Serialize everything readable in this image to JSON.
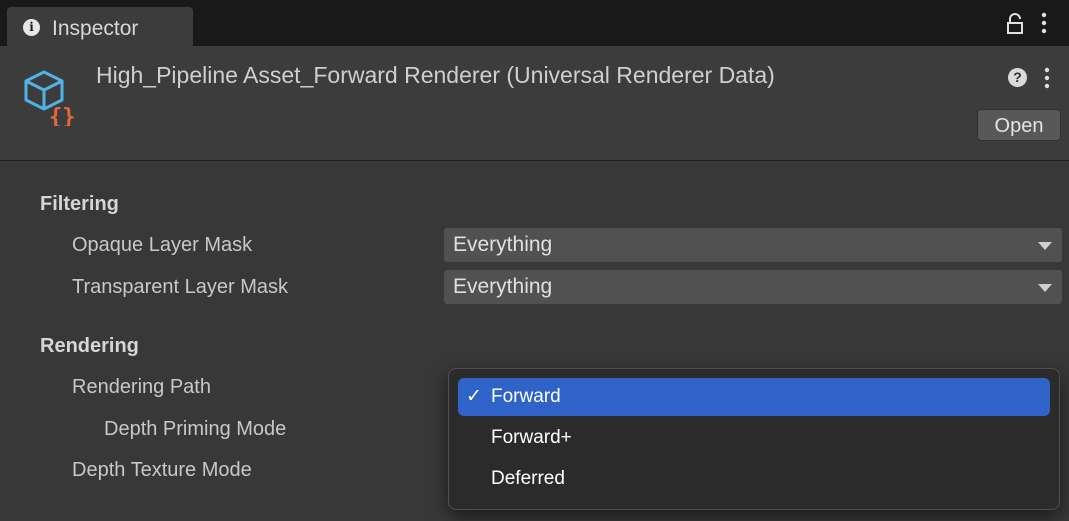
{
  "tab": {
    "title": "Inspector",
    "info_icon": "info-icon"
  },
  "header": {
    "title": "High_Pipeline Asset_Forward Renderer (Universal Renderer Data)",
    "help_glyph": "?",
    "open_label": "Open"
  },
  "filtering": {
    "header": "Filtering",
    "opaque_label": "Opaque Layer Mask",
    "opaque_value": "Everything",
    "transparent_label": "Transparent Layer Mask",
    "transparent_value": "Everything"
  },
  "rendering": {
    "header": "Rendering",
    "path_label": "Rendering Path",
    "depth_priming_label": "Depth Priming Mode",
    "depth_texture_label": "Depth Texture Mode"
  },
  "dropdown": {
    "check": "✓",
    "options": [
      {
        "label": "Forward",
        "selected": true
      },
      {
        "label": "Forward+",
        "selected": false
      },
      {
        "label": "Deferred",
        "selected": false
      }
    ]
  },
  "colors": {
    "accent_selected": "#2f63c9",
    "asset_icon_blue": "#4fb3e8",
    "asset_icon_orange": "#e8673a",
    "panel_bg": "#383838"
  }
}
